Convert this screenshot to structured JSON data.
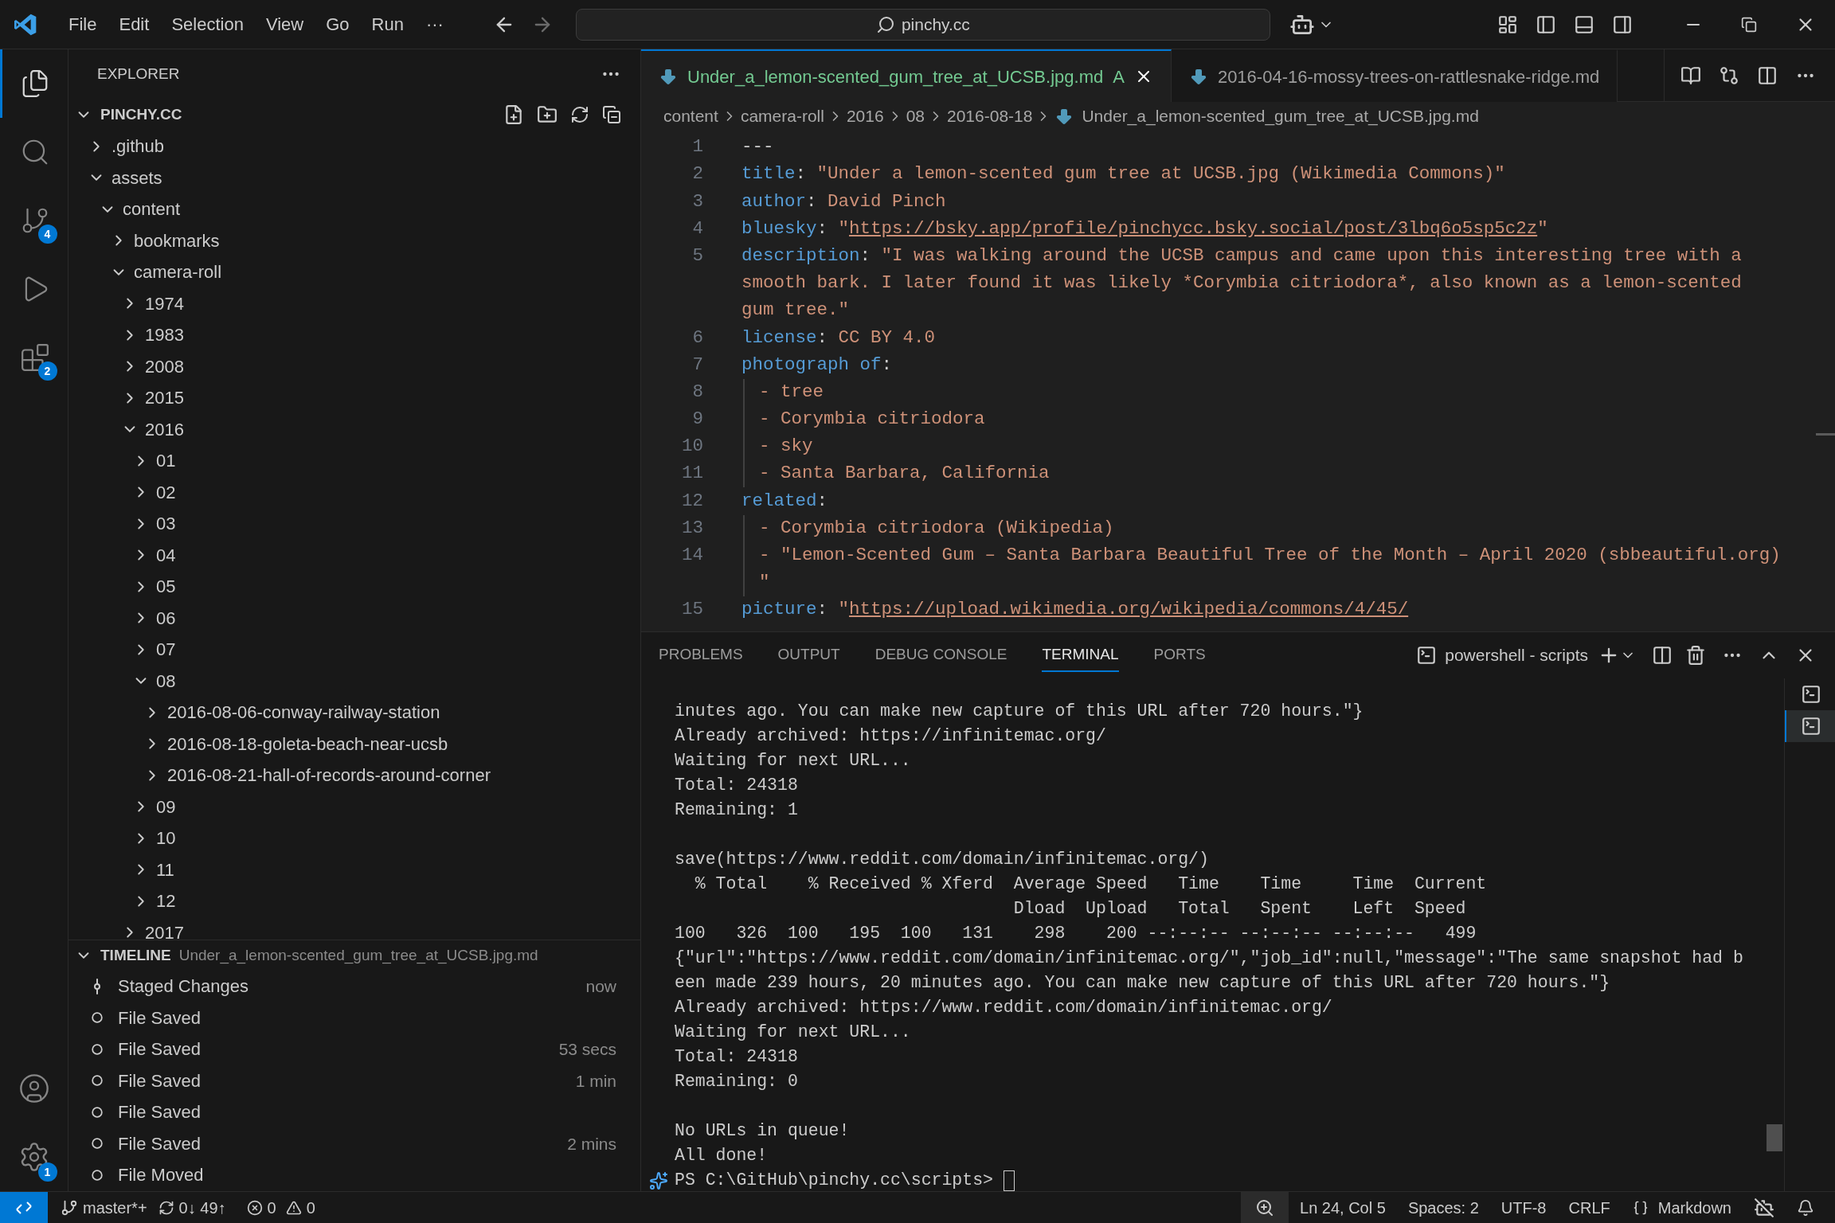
{
  "menu": [
    "File",
    "Edit",
    "Selection",
    "View",
    "Go",
    "Run",
    "···"
  ],
  "search": {
    "value": "pinchy.cc"
  },
  "activity_bar": {
    "items": [
      {
        "kind": "files",
        "selected": true
      },
      {
        "kind": "search",
        "selected": false
      },
      {
        "kind": "source-control",
        "selected": false,
        "badge": "4"
      },
      {
        "kind": "run",
        "selected": false
      },
      {
        "kind": "extensions",
        "selected": false,
        "badge": "2"
      }
    ],
    "bottom": [
      {
        "kind": "account"
      },
      {
        "kind": "settings",
        "badge": "1"
      }
    ]
  },
  "explorer": {
    "title": "EXPLORER",
    "workspace": {
      "name": "PINCHY.CC",
      "expanded": true
    },
    "tree": [
      {
        "label": ".github",
        "expanded": false
      },
      {
        "label": "assets",
        "expanded": true,
        "children": [
          {
            "label": "content",
            "expanded": true,
            "children": [
              {
                "label": "bookmarks",
                "expanded": false
              },
              {
                "label": "camera-roll",
                "expanded": true,
                "children": [
                  {
                    "label": "1974",
                    "expanded": false
                  },
                  {
                    "label": "1983",
                    "expanded": false
                  },
                  {
                    "label": "2008",
                    "expanded": false
                  },
                  {
                    "label": "2015",
                    "expanded": false
                  },
                  {
                    "label": "2016",
                    "expanded": true,
                    "children": [
                      {
                        "label": "01",
                        "expanded": false
                      },
                      {
                        "label": "02",
                        "expanded": false
                      },
                      {
                        "label": "03",
                        "expanded": false
                      },
                      {
                        "label": "04",
                        "expanded": false
                      },
                      {
                        "label": "05",
                        "expanded": false
                      },
                      {
                        "label": "06",
                        "expanded": false
                      },
                      {
                        "label": "07",
                        "expanded": false
                      },
                      {
                        "label": "08",
                        "expanded": true,
                        "children": [
                          {
                            "label": "2016-08-06-conway-railway-station",
                            "expanded": false
                          },
                          {
                            "label": "2016-08-18-goleta-beach-near-ucsb",
                            "expanded": false
                          },
                          {
                            "label": "2016-08-21-hall-of-records-around-corner",
                            "expanded": false
                          }
                        ]
                      },
                      {
                        "label": "09",
                        "expanded": false
                      },
                      {
                        "label": "10",
                        "expanded": false
                      },
                      {
                        "label": "11",
                        "expanded": false
                      },
                      {
                        "label": "12",
                        "expanded": false
                      }
                    ]
                  },
                  {
                    "label": "2017",
                    "expanded": false
                  }
                ]
              }
            ]
          }
        ]
      }
    ]
  },
  "timeline": {
    "title": "TIMELINE",
    "file": "Under_a_lemon-scented_gum_tree_at_UCSB.jpg.md",
    "expanded": true,
    "items": [
      {
        "kind": "staged",
        "label": "Staged Changes",
        "time": "now"
      },
      {
        "kind": "saved",
        "label": "File Saved"
      },
      {
        "kind": "saved",
        "label": "File Saved",
        "time": "53 secs"
      },
      {
        "kind": "saved",
        "label": "File Saved",
        "time": "1 min"
      },
      {
        "kind": "saved",
        "label": "File Saved"
      },
      {
        "kind": "saved",
        "label": "File Saved",
        "time": "2 mins"
      },
      {
        "kind": "saved",
        "label": "File Moved"
      }
    ]
  },
  "tabs": [
    {
      "label": "Under_a_lemon-scented_gum_tree_at_UCSB.jpg.md",
      "selected": true,
      "status": "A"
    },
    {
      "label": "2016-04-16-mossy-trees-on-rattlesnake-ridge.md",
      "selected": false
    }
  ],
  "breadcrumbs": [
    "content",
    "camera-roll",
    "2016",
    "08",
    "2016-08-18",
    "Under_a_lemon-scented_gum_tree_at_UCSB.jpg.md"
  ],
  "code": [
    {
      "number": "1",
      "parts": [
        {
          "kind": "plain",
          "text": "---"
        }
      ]
    },
    {
      "number": "2",
      "parts": [
        {
          "kind": "key",
          "text": "title"
        },
        {
          "kind": "punct",
          "text": ": "
        },
        {
          "kind": "string",
          "text": "\"Under a lemon-scented gum tree at UCSB.jpg (Wikimedia Commons)\""
        }
      ]
    },
    {
      "number": "3",
      "parts": [
        {
          "kind": "key",
          "text": "author"
        },
        {
          "kind": "punct",
          "text": ": "
        },
        {
          "kind": "string",
          "text": "David Pinch"
        }
      ]
    },
    {
      "number": "4",
      "parts": [
        {
          "kind": "key",
          "text": "bluesky"
        },
        {
          "kind": "punct",
          "text": ": "
        },
        {
          "kind": "string",
          "text": "\""
        },
        {
          "kind": "link",
          "text": "https://bsky.app/profile/pinchycc.bsky.social/post/3lbq6o5sp5c2z"
        },
        {
          "kind": "string",
          "text": "\""
        }
      ]
    },
    {
      "number": "5",
      "parts": [
        {
          "kind": "key",
          "text": "description"
        },
        {
          "kind": "punct",
          "text": ": "
        },
        {
          "kind": "string",
          "text": "\"I was walking around the UCSB campus and came upon this interesting tree with a"
        }
      ]
    },
    {
      "parts": [
        {
          "kind": "string",
          "text": "smooth bark. I later found it was likely *Corymbia citriodora*, also known as a lemon-scented"
        }
      ]
    },
    {
      "parts": [
        {
          "kind": "string",
          "text": "gum tree.\""
        }
      ]
    },
    {
      "number": "6",
      "parts": [
        {
          "kind": "key",
          "text": "license"
        },
        {
          "kind": "punct",
          "text": ": "
        },
        {
          "kind": "string",
          "text": "CC BY 4.0"
        }
      ]
    },
    {
      "number": "7",
      "parts": [
        {
          "kind": "key",
          "text": "photograph of"
        },
        {
          "kind": "punct",
          "text": ":"
        }
      ]
    },
    {
      "number": "8",
      "guide": true,
      "parts": [
        {
          "kind": "string",
          "text": "- tree"
        }
      ]
    },
    {
      "number": "9",
      "guide": true,
      "parts": [
        {
          "kind": "string",
          "text": "- Corymbia citriodora"
        }
      ]
    },
    {
      "number": "10",
      "guide": true,
      "parts": [
        {
          "kind": "string",
          "text": "- sky"
        }
      ]
    },
    {
      "number": "11",
      "guide": true,
      "parts": [
        {
          "kind": "string",
          "text": "- Santa Barbara, California"
        }
      ]
    },
    {
      "number": "12",
      "parts": [
        {
          "kind": "key",
          "text": "related"
        },
        {
          "kind": "punct",
          "text": ":"
        }
      ]
    },
    {
      "number": "13",
      "guide": true,
      "parts": [
        {
          "kind": "string",
          "text": "- Corymbia citriodora (Wikipedia)"
        }
      ]
    },
    {
      "number": "14",
      "guide": true,
      "parts": [
        {
          "kind": "string",
          "text": "- \"Lemon-Scented Gum – Santa Barbara Beautiful Tree of the Month – April 2020 (sbbeautiful.org)"
        }
      ]
    },
    {
      "guide": true,
      "parts": [
        {
          "kind": "string",
          "text": "\""
        }
      ]
    },
    {
      "number": "15",
      "parts": [
        {
          "kind": "key",
          "text": "picture"
        },
        {
          "kind": "punct",
          "text": ": "
        },
        {
          "kind": "string",
          "text": "\""
        },
        {
          "kind": "link",
          "text": "https://upload.wikimedia.org/wikipedia/commons/4/45/"
        }
      ]
    }
  ],
  "panel": {
    "tabs": [
      {
        "label": "PROBLEMS",
        "selected": false
      },
      {
        "label": "OUTPUT",
        "selected": false
      },
      {
        "label": "DEBUG CONSOLE",
        "selected": false
      },
      {
        "label": "TERMINAL",
        "selected": true
      },
      {
        "label": "PORTS",
        "selected": false
      }
    ],
    "terminal_name": "powershell - scripts",
    "terminals": [
      {
        "selected": false
      },
      {
        "selected": true
      }
    ],
    "blocks": [
      [
        "inutes ago. You can make new capture of this URL after 720 hours.\"}",
        "Already archived: https://infinitemac.org/",
        "Waiting for next URL...",
        "Total: 24318",
        "Remaining: 1"
      ],
      [
        "save(https://www.reddit.com/domain/infinitemac.org/)",
        "  % Total    % Received % Xferd  Average Speed   Time    Time     Time  Current",
        "                                 Dload  Upload   Total   Spent    Left  Speed",
        "100   326  100   195  100   131    298    200 --:--:-- --:--:-- --:--:--   499",
        "{\"url\":\"https://www.reddit.com/domain/infinitemac.org/\",\"job_id\":null,\"message\":\"The same snapshot had b",
        "een made 239 hours, 20 minutes ago. You can make new capture of this URL after 720 hours.\"}",
        "Already archived: https://www.reddit.com/domain/infinitemac.org/",
        "Waiting for next URL...",
        "Total: 24318",
        "Remaining: 0"
      ],
      [
        "No URLs in queue!",
        "All done!"
      ]
    ],
    "prompt": "PS C:\\GitHub\\pinchy.cc\\scripts> "
  },
  "status_bar": {
    "branch": "master*+",
    "sync": "0↓ 49↑",
    "errors": "0",
    "warnings": "0",
    "position": "Ln 24, Col 5",
    "spaces": "Spaces: 2",
    "encoding": "UTF-8",
    "eol": "CRLF",
    "language": "Markdown"
  }
}
